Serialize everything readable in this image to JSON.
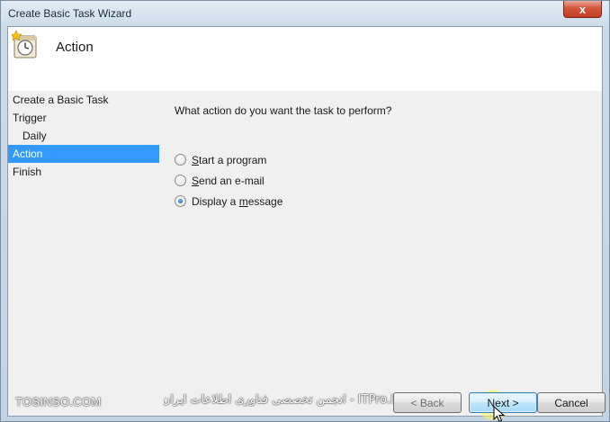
{
  "window": {
    "title": "Create Basic Task Wizard",
    "close_glyph": "x"
  },
  "header": {
    "icon": "task-scheduler-icon",
    "title": "Action"
  },
  "steps": [
    {
      "label": "Create a Basic Task",
      "level": 0,
      "active": false
    },
    {
      "label": "Trigger",
      "level": 0,
      "active": false
    },
    {
      "label": "Daily",
      "level": 1,
      "active": false
    },
    {
      "label": "Action",
      "level": 0,
      "active": true
    },
    {
      "label": "Finish",
      "level": 0,
      "active": false
    }
  ],
  "main": {
    "question": "What action do you want the task to perform?",
    "options": [
      {
        "before": "",
        "mnemonic": "S",
        "after": "tart a program",
        "checked": false
      },
      {
        "before": "",
        "mnemonic": "S",
        "after": "end an e-mail",
        "checked": false
      },
      {
        "before": "Display a ",
        "mnemonic": "m",
        "after": "essage",
        "checked": true
      }
    ]
  },
  "footer": {
    "brand": "TOSINSO.COM",
    "watermark": "ITPro.ir - انجمن تخصصی فناوری اطلاعات ایران",
    "back_label": "< Back",
    "next_label": "Next >",
    "cancel_label": "Cancel"
  },
  "colors": {
    "selection": "#3399ff",
    "close": "#c13e22",
    "window_frame": "#c4d3e2"
  }
}
